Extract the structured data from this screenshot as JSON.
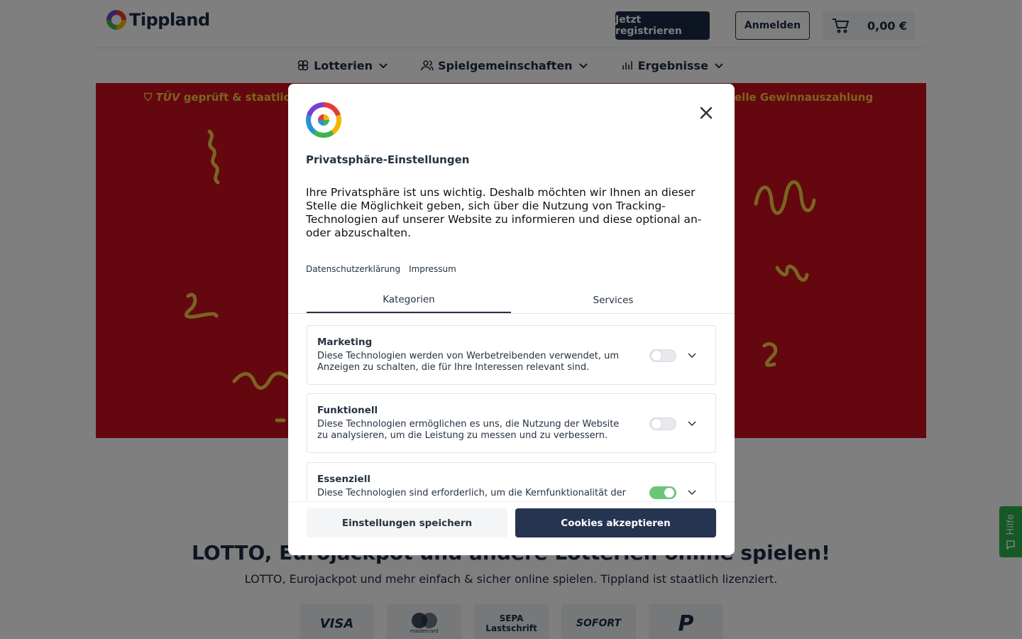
{
  "header": {
    "logo_text": "Tippland",
    "register_label": "Jetzt registrieren",
    "login_label": "Anmelden",
    "cart_amount": "0,00 €"
  },
  "nav": [
    {
      "label": "Lotterien",
      "icon": "clover-icon"
    },
    {
      "label": "Spielgemeinschaften",
      "icon": "users-icon"
    },
    {
      "label": "Ergebnisse",
      "icon": "bar-chart-icon"
    }
  ],
  "hero": {
    "badge_left": "geprüft & staatlich",
    "badge_right": "elle Gewinnauszahlung"
  },
  "main": {
    "headline": "LOTTO, Eurojackpot und andere Lotterien online spielen!",
    "subline": "LOTTO, Eurojackpot und mehr einfach & sicher online spielen. Tippland ist staatlich lizenziert.",
    "payments": [
      {
        "label": "VISA"
      },
      {
        "label": "mastercard"
      },
      {
        "label": "SEPA Lastschrift"
      },
      {
        "label": "SOFORT"
      },
      {
        "label": "PayPal"
      }
    ]
  },
  "help": {
    "label": "Hilfe"
  },
  "modal": {
    "title": "Privatsphäre-Einstellungen",
    "description": "Ihre Privatsphäre ist uns wichtig. Deshalb möchten wir Ihnen an dieser Stelle die Möglichkeit geben, sich über die Nutzung von Tracking-Technologien auf unserer Website zu informieren und diese optional an- oder abzuschalten.",
    "links": [
      "Datenschutzerklärung",
      "Impressum"
    ],
    "tabs": [
      {
        "label": "Kategorien",
        "active": true
      },
      {
        "label": "Services",
        "active": false
      }
    ],
    "categories": [
      {
        "title": "Marketing",
        "description": "Diese Technologien werden von Werbetreibenden verwendet, um Anzeigen zu schalten, die für Ihre Interessen relevant sind.",
        "enabled": false
      },
      {
        "title": "Funktionell",
        "description": "Diese Technologien ermöglichen es uns, die Nutzung der Website zu analysieren, um die Leistung zu messen und zu verbessern.",
        "enabled": false
      },
      {
        "title": "Essenziell",
        "description": "Diese Technologien sind erforderlich, um die Kernfunktionalität der",
        "enabled": true
      }
    ],
    "save_label": "Einstellungen speichern",
    "accept_label": "Cookies akzeptieren"
  },
  "colors": {
    "brand_dark": "#1c2b45",
    "hero_red": "#c90f1e",
    "accent_yellow": "#f6c945",
    "toggle_on": "#6cc67a",
    "help_green": "#2bb24c"
  }
}
